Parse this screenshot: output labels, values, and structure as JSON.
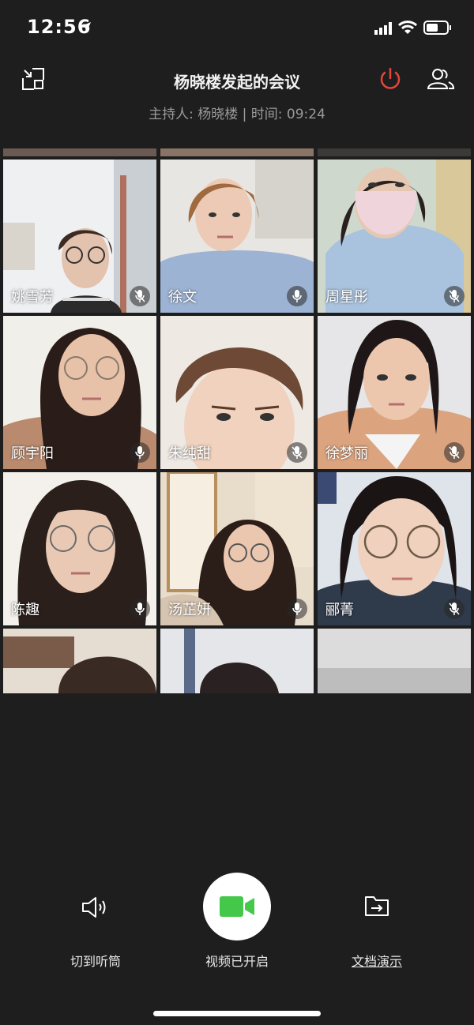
{
  "status_bar": {
    "time": "12:56"
  },
  "header": {
    "title": "杨晓楼发起的会议",
    "subtitle": "主持人: 杨晓楼 | 时间: 09:24"
  },
  "participants": [
    {
      "name": "姚雪芳",
      "muted": true
    },
    {
      "name": "徐文",
      "muted": false
    },
    {
      "name": "周星彤",
      "muted": true
    },
    {
      "name": "顾宇阳",
      "muted": false
    },
    {
      "name": "朱纯甜",
      "muted": true
    },
    {
      "name": "徐梦丽",
      "muted": true
    },
    {
      "name": "陈趣",
      "muted": false
    },
    {
      "name": "汤芷妍",
      "muted": false
    },
    {
      "name": "郦菁",
      "muted": true
    }
  ],
  "controls": {
    "speaker_label": "切到听筒",
    "video_label": "视频已开启",
    "doc_label": "文档演示"
  },
  "colors": {
    "background": "#1e1e1e",
    "accent_green": "#44c84a",
    "power_red": "#e2463b"
  }
}
